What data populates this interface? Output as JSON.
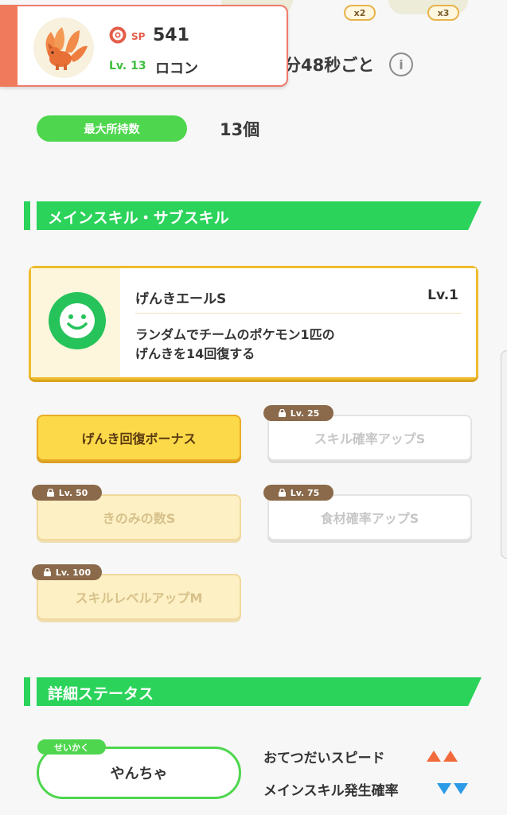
{
  "top": {
    "multipliers": [
      "x2",
      "x3"
    ],
    "interval_text": "分48秒ごと",
    "info_icon": "info-icon"
  },
  "pokemon": {
    "sp_label": "SP",
    "sp_value": "541",
    "level": "Lv. 13",
    "name": "ロコン",
    "accent": "#f07a5c"
  },
  "max_inventory": {
    "label": "最大所持数",
    "value": "13個"
  },
  "skills_section": {
    "title": "メインスキル・サブスキル",
    "main_skill": {
      "name": "げんきエールS",
      "level": "Lv.1",
      "description_line1": "ランダムでチームのポケモン1匹の",
      "description_line2": "げんきを14回復する",
      "icon": "smile-icon"
    },
    "sub_skills": [
      {
        "label": "げんき回復ボーナス",
        "lock": "",
        "state": "active"
      },
      {
        "label": "スキル確率アップS",
        "lock": "Lv. 25",
        "state": "locked"
      },
      {
        "label": "きのみの数S",
        "lock": "Lv. 50",
        "state": "locked"
      },
      {
        "label": "食材確率アップS",
        "lock": "Lv. 75",
        "state": "locked"
      },
      {
        "label": "スキルレベルアップM",
        "lock": "Lv. 100",
        "state": "locked"
      }
    ]
  },
  "detail_section": {
    "title": "詳細ステータス",
    "nature_tag": "せいかく",
    "nature": "やんちゃ",
    "effects": [
      {
        "label": "おてつだいスピード",
        "direction": "up",
        "color": "#f26a3c"
      },
      {
        "label": "メインスキル発生確率",
        "direction": "down",
        "color": "#2b9be8"
      }
    ]
  },
  "colors": {
    "green": "#2bd35a",
    "gold": "#eebc2c"
  }
}
